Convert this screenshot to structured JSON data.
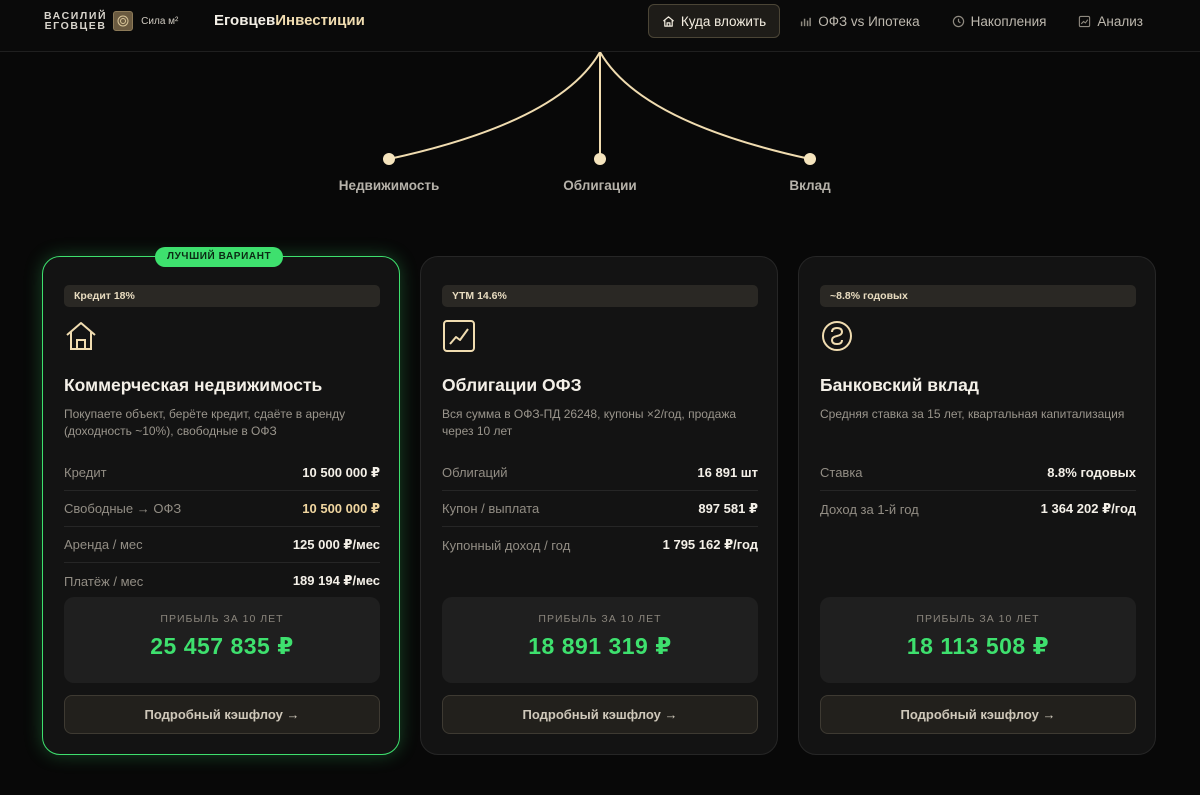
{
  "header": {
    "brand_line1": "ВАСИЛИЙ",
    "brand_line2": "ЕГОВЦЕВ",
    "slogan": "Сила м²",
    "title_part1": "Еговцев",
    "title_part2": "Инвестиции",
    "nav": [
      {
        "label": "Куда вложить",
        "icon": "home-icon",
        "active": true
      },
      {
        "label": "ОФЗ vs Ипотека",
        "icon": "bar-chart-icon",
        "active": false
      },
      {
        "label": "Накопления",
        "icon": "clock-icon",
        "active": false
      },
      {
        "label": "Анализ",
        "icon": "line-chart-icon",
        "active": false
      }
    ]
  },
  "tree": {
    "labels": [
      "Недвижимость",
      "Облигации",
      "Вклад"
    ],
    "accent_color": "#f0dcb0"
  },
  "colors": {
    "accent_green": "#3ee06e",
    "accent_gold": "#f0d6a0"
  },
  "cards": [
    {
      "best_badge": "ЛУЧШИЙ ВАРИАНТ",
      "tag": "Кредит 18%",
      "icon": "house-icon",
      "title": "Коммерческая недвижимость",
      "desc": "Покупаете объект, берёте кредит, сдаёте в аренду (доходность ~10%), свободные в ОФЗ",
      "rows": [
        {
          "k": "Кредит",
          "v": "10 500 000 ₽"
        },
        {
          "k": "Свободные → ОФЗ",
          "v": "10 500 000 ₽"
        },
        {
          "k": "Аренда / мес",
          "v": "125 000 ₽/мес"
        },
        {
          "k": "Платёж / мес",
          "v": "189 194 ₽/мес"
        }
      ],
      "profit_label": "ПРИБЫЛЬ ЗА 10 ЛЕТ",
      "profit_value": "25 457 835 ₽",
      "button": "Подробный кэшфлоу →"
    },
    {
      "tag": "YTM 14.6%",
      "icon": "trend-chart-icon",
      "title": "Облигации ОФЗ",
      "desc": "Вся сумма в ОФЗ-ПД 26248, купоны ×2/год, продажа через 10 лет",
      "rows": [
        {
          "k": "Облигаций",
          "v": "16 891 шт"
        },
        {
          "k": "Купон / выплата",
          "v": "897 581 ₽"
        },
        {
          "k": "Купонный доход / год",
          "v": "1 795 162 ₽/год"
        }
      ],
      "profit_label": "ПРИБЫЛЬ ЗА 10 ЛЕТ",
      "profit_value": "18 891 319 ₽",
      "button": "Подробный кэшфлоу →"
    },
    {
      "tag": "~8.8% годовых",
      "icon": "coin-icon",
      "title": "Банковский вклад",
      "desc": "Средняя ставка за 15 лет, квартальная капитализация",
      "rows": [
        {
          "k": "Ставка",
          "v": "8.8% годовых"
        },
        {
          "k": "Доход за 1-й год",
          "v": "1 364 202 ₽/год"
        }
      ],
      "profit_label": "ПРИБЫЛЬ ЗА 10 ЛЕТ",
      "profit_value": "18 113 508 ₽",
      "button": "Подробный кэшфлоу →"
    }
  ]
}
